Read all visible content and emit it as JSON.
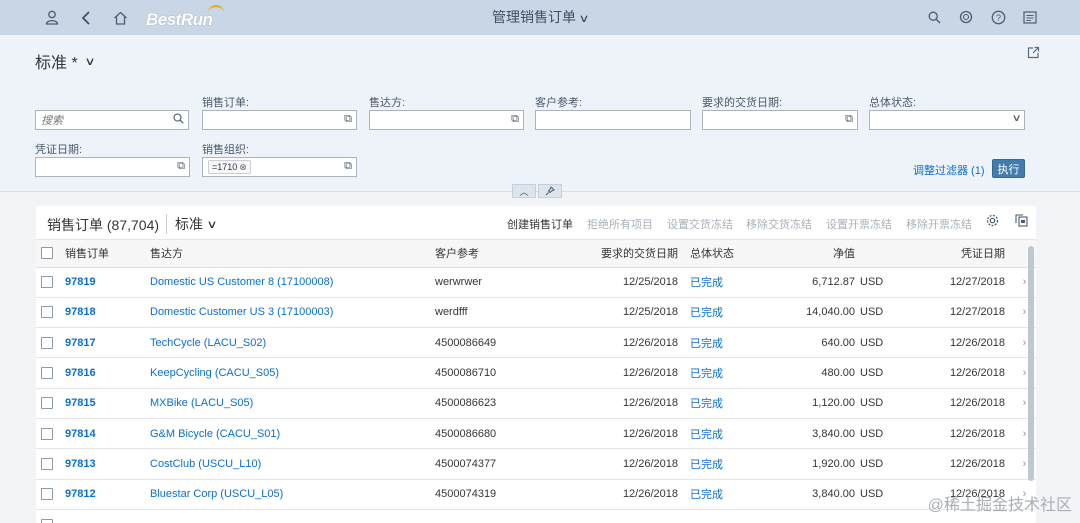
{
  "shell": {
    "user_icon": "user-icon",
    "back_icon": "back-icon",
    "home_icon": "home-icon",
    "logo": "BestRun",
    "title": "管理销售订单",
    "search_icon": "search-icon",
    "copilot_icon": "copilot-icon",
    "help_icon": "help-icon",
    "notes_icon": "notes-icon"
  },
  "header": {
    "variant": "标准 *",
    "filters": {
      "search_placeholder": "搜索",
      "sales_order_label": "销售订单:",
      "sold_to_label": "售达方:",
      "cust_ref_label": "客户参考:",
      "req_date_label": "要求的交货日期:",
      "overall_status_label": "总体状态:",
      "doc_date_label": "凭证日期:",
      "sales_org_label": "销售组织:",
      "sales_org_token": "=1710"
    },
    "adapt_filters": "调整过滤器 (1)",
    "go": "执行"
  },
  "table": {
    "title": "销售订单 (87,704)",
    "variant": "标准",
    "toolbar": {
      "create": "创建销售订单",
      "reject_all": "拒绝所有项目",
      "set_delivery_block": "设置交货冻结",
      "remove_delivery_block": "移除交货冻结",
      "set_billing_block": "设置开票冻结",
      "remove_billing_block": "移除开票冻结"
    },
    "columns": {
      "sales_order": "销售订单",
      "sold_to": "售达方",
      "cust_ref": "客户参考",
      "req_date": "要求的交货日期",
      "status": "总体状态",
      "net_value": "净值",
      "doc_date": "凭证日期"
    },
    "rows": [
      {
        "so": "97819",
        "sold_to": "Domestic US Customer 8 (17100008)",
        "ref": "werwrwer",
        "req": "12/25/2018",
        "status": "已完成",
        "net": "6,712.87",
        "cur": "USD",
        "doc": "12/27/2018"
      },
      {
        "so": "97818",
        "sold_to": "Domestic Customer US 3 (17100003)",
        "ref": "werdfff",
        "req": "12/25/2018",
        "status": "已完成",
        "net": "14,040.00",
        "cur": "USD",
        "doc": "12/27/2018"
      },
      {
        "so": "97817",
        "sold_to": "TechCycle (LACU_S02)",
        "ref": "4500086649",
        "req": "12/26/2018",
        "status": "已完成",
        "net": "640.00",
        "cur": "USD",
        "doc": "12/26/2018"
      },
      {
        "so": "97816",
        "sold_to": "KeepCycling (CACU_S05)",
        "ref": "4500086710",
        "req": "12/26/2018",
        "status": "已完成",
        "net": "480.00",
        "cur": "USD",
        "doc": "12/26/2018"
      },
      {
        "so": "97815",
        "sold_to": "MXBike (LACU_S05)",
        "ref": "4500086623",
        "req": "12/26/2018",
        "status": "已完成",
        "net": "1,120.00",
        "cur": "USD",
        "doc": "12/26/2018"
      },
      {
        "so": "97814",
        "sold_to": "G&M Bicycle (CACU_S01)",
        "ref": "4500086680",
        "req": "12/26/2018",
        "status": "已完成",
        "net": "3,840.00",
        "cur": "USD",
        "doc": "12/26/2018"
      },
      {
        "so": "97813",
        "sold_to": "CostClub (USCU_L10)",
        "ref": "4500074377",
        "req": "12/26/2018",
        "status": "已完成",
        "net": "1,920.00",
        "cur": "USD",
        "doc": "12/26/2018"
      },
      {
        "so": "97812",
        "sold_to": "Bluestar Corp (USCU_L05)",
        "ref": "4500074319",
        "req": "12/26/2018",
        "status": "已完成",
        "net": "3,840.00",
        "cur": "USD",
        "doc": "12/26/2018"
      },
      {
        "so": "",
        "sold_to": "",
        "ref": "",
        "req": "",
        "status": "",
        "net": "",
        "cur": "",
        "doc": ""
      }
    ]
  },
  "watermark": "@稀土掘金技术社区"
}
